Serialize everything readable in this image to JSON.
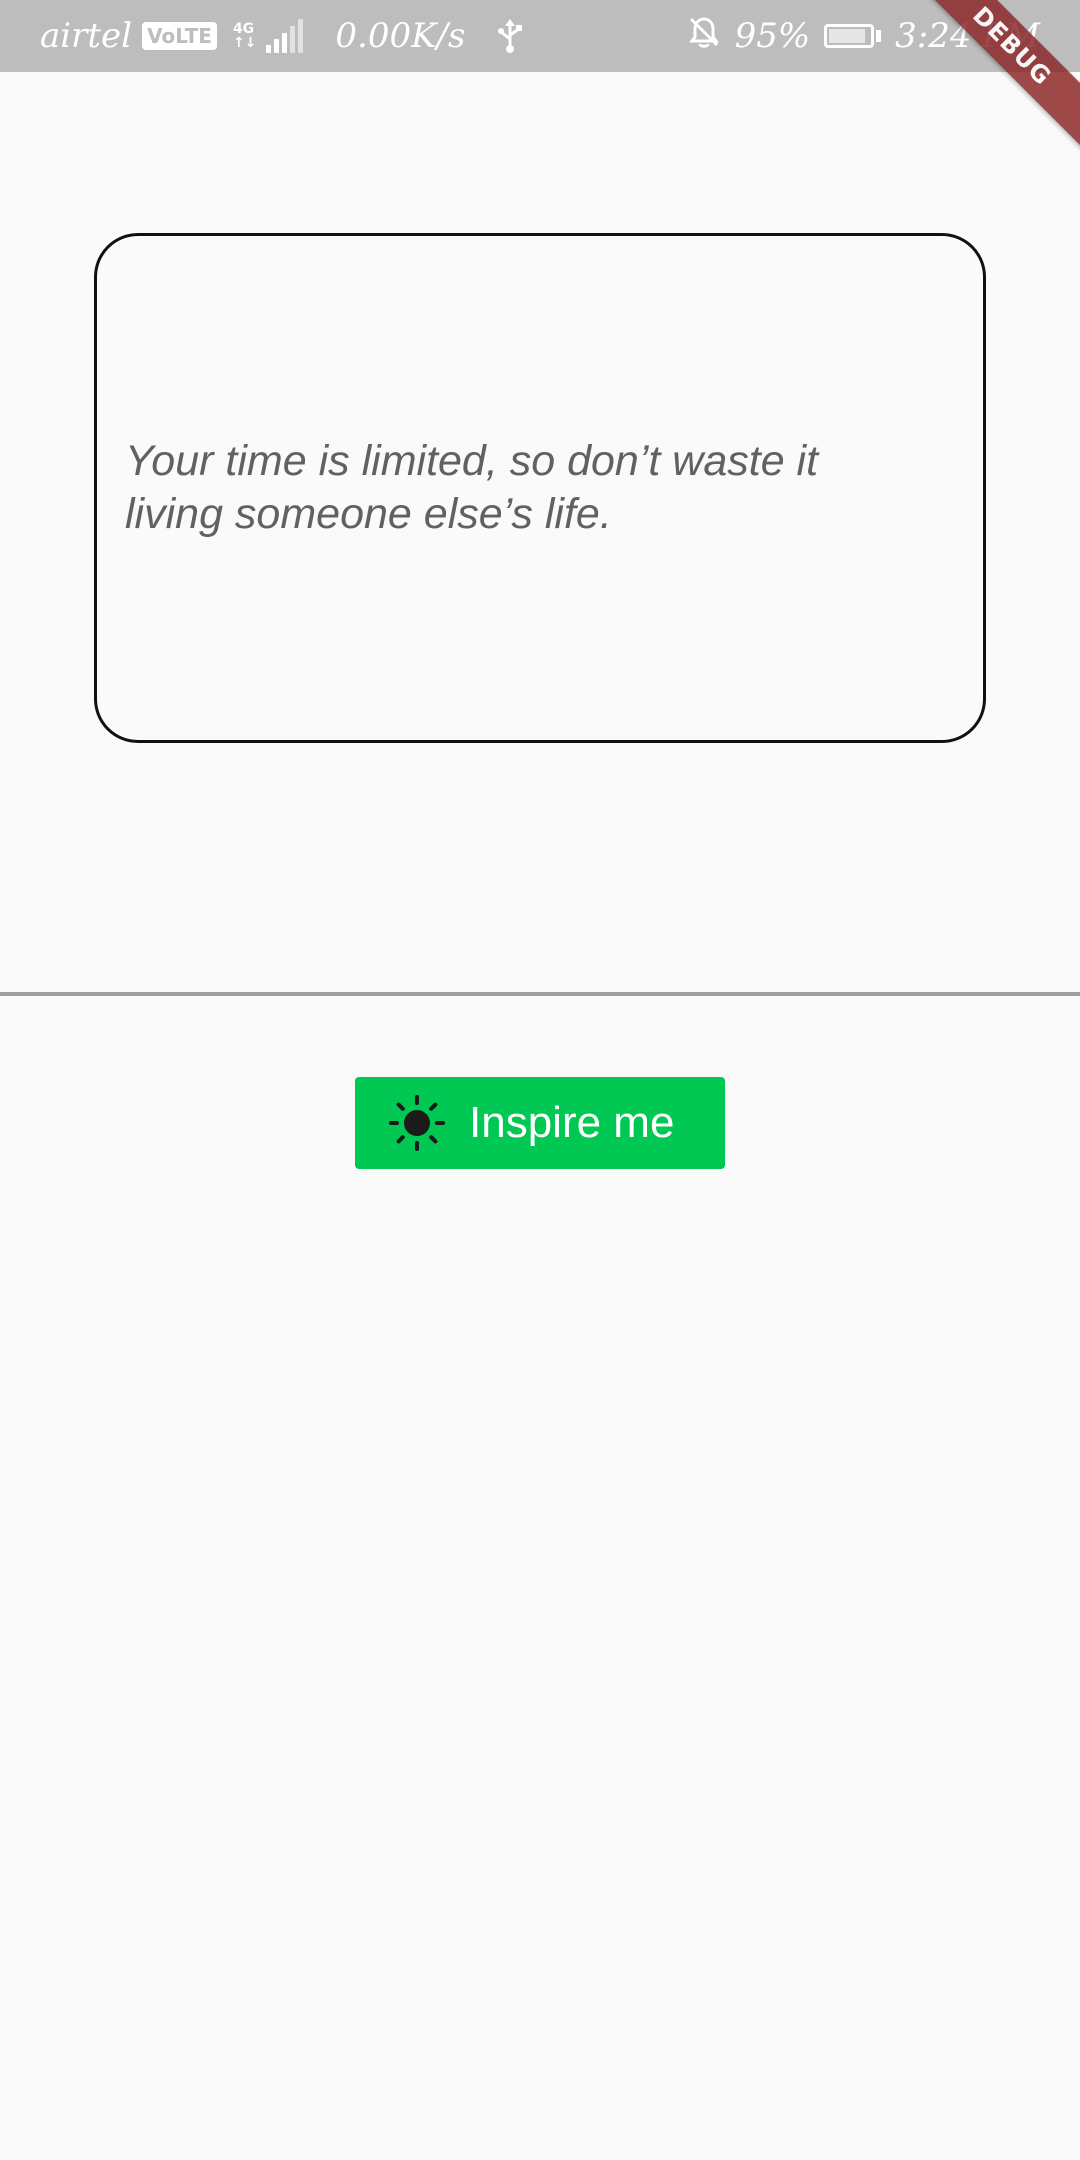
{
  "status_bar": {
    "carrier": "airtel",
    "volte_badge": "VoLTE",
    "network_type": "4G",
    "network_sub": "↑↓",
    "speed": "0.00K/s",
    "battery_percent": "95%",
    "battery_level": 0.95,
    "time": "3:24 PM",
    "icons": [
      "signal-icon",
      "usb-icon",
      "bell-off-icon",
      "battery-charging-icon"
    ]
  },
  "debug_banner": {
    "label": "DEBUG",
    "color": "#8e2a2a"
  },
  "quote": {
    "text": "Your time is limited, so don’t waste it living someone else’s life."
  },
  "inspire_button": {
    "label": "Inspire me",
    "icon": "sun-icon",
    "background": "#00c853"
  },
  "colors": {
    "background": "#fafafa",
    "status_bar": "#bdbdbd",
    "divider": "#9e9e9e",
    "quote_text": "#616161"
  }
}
